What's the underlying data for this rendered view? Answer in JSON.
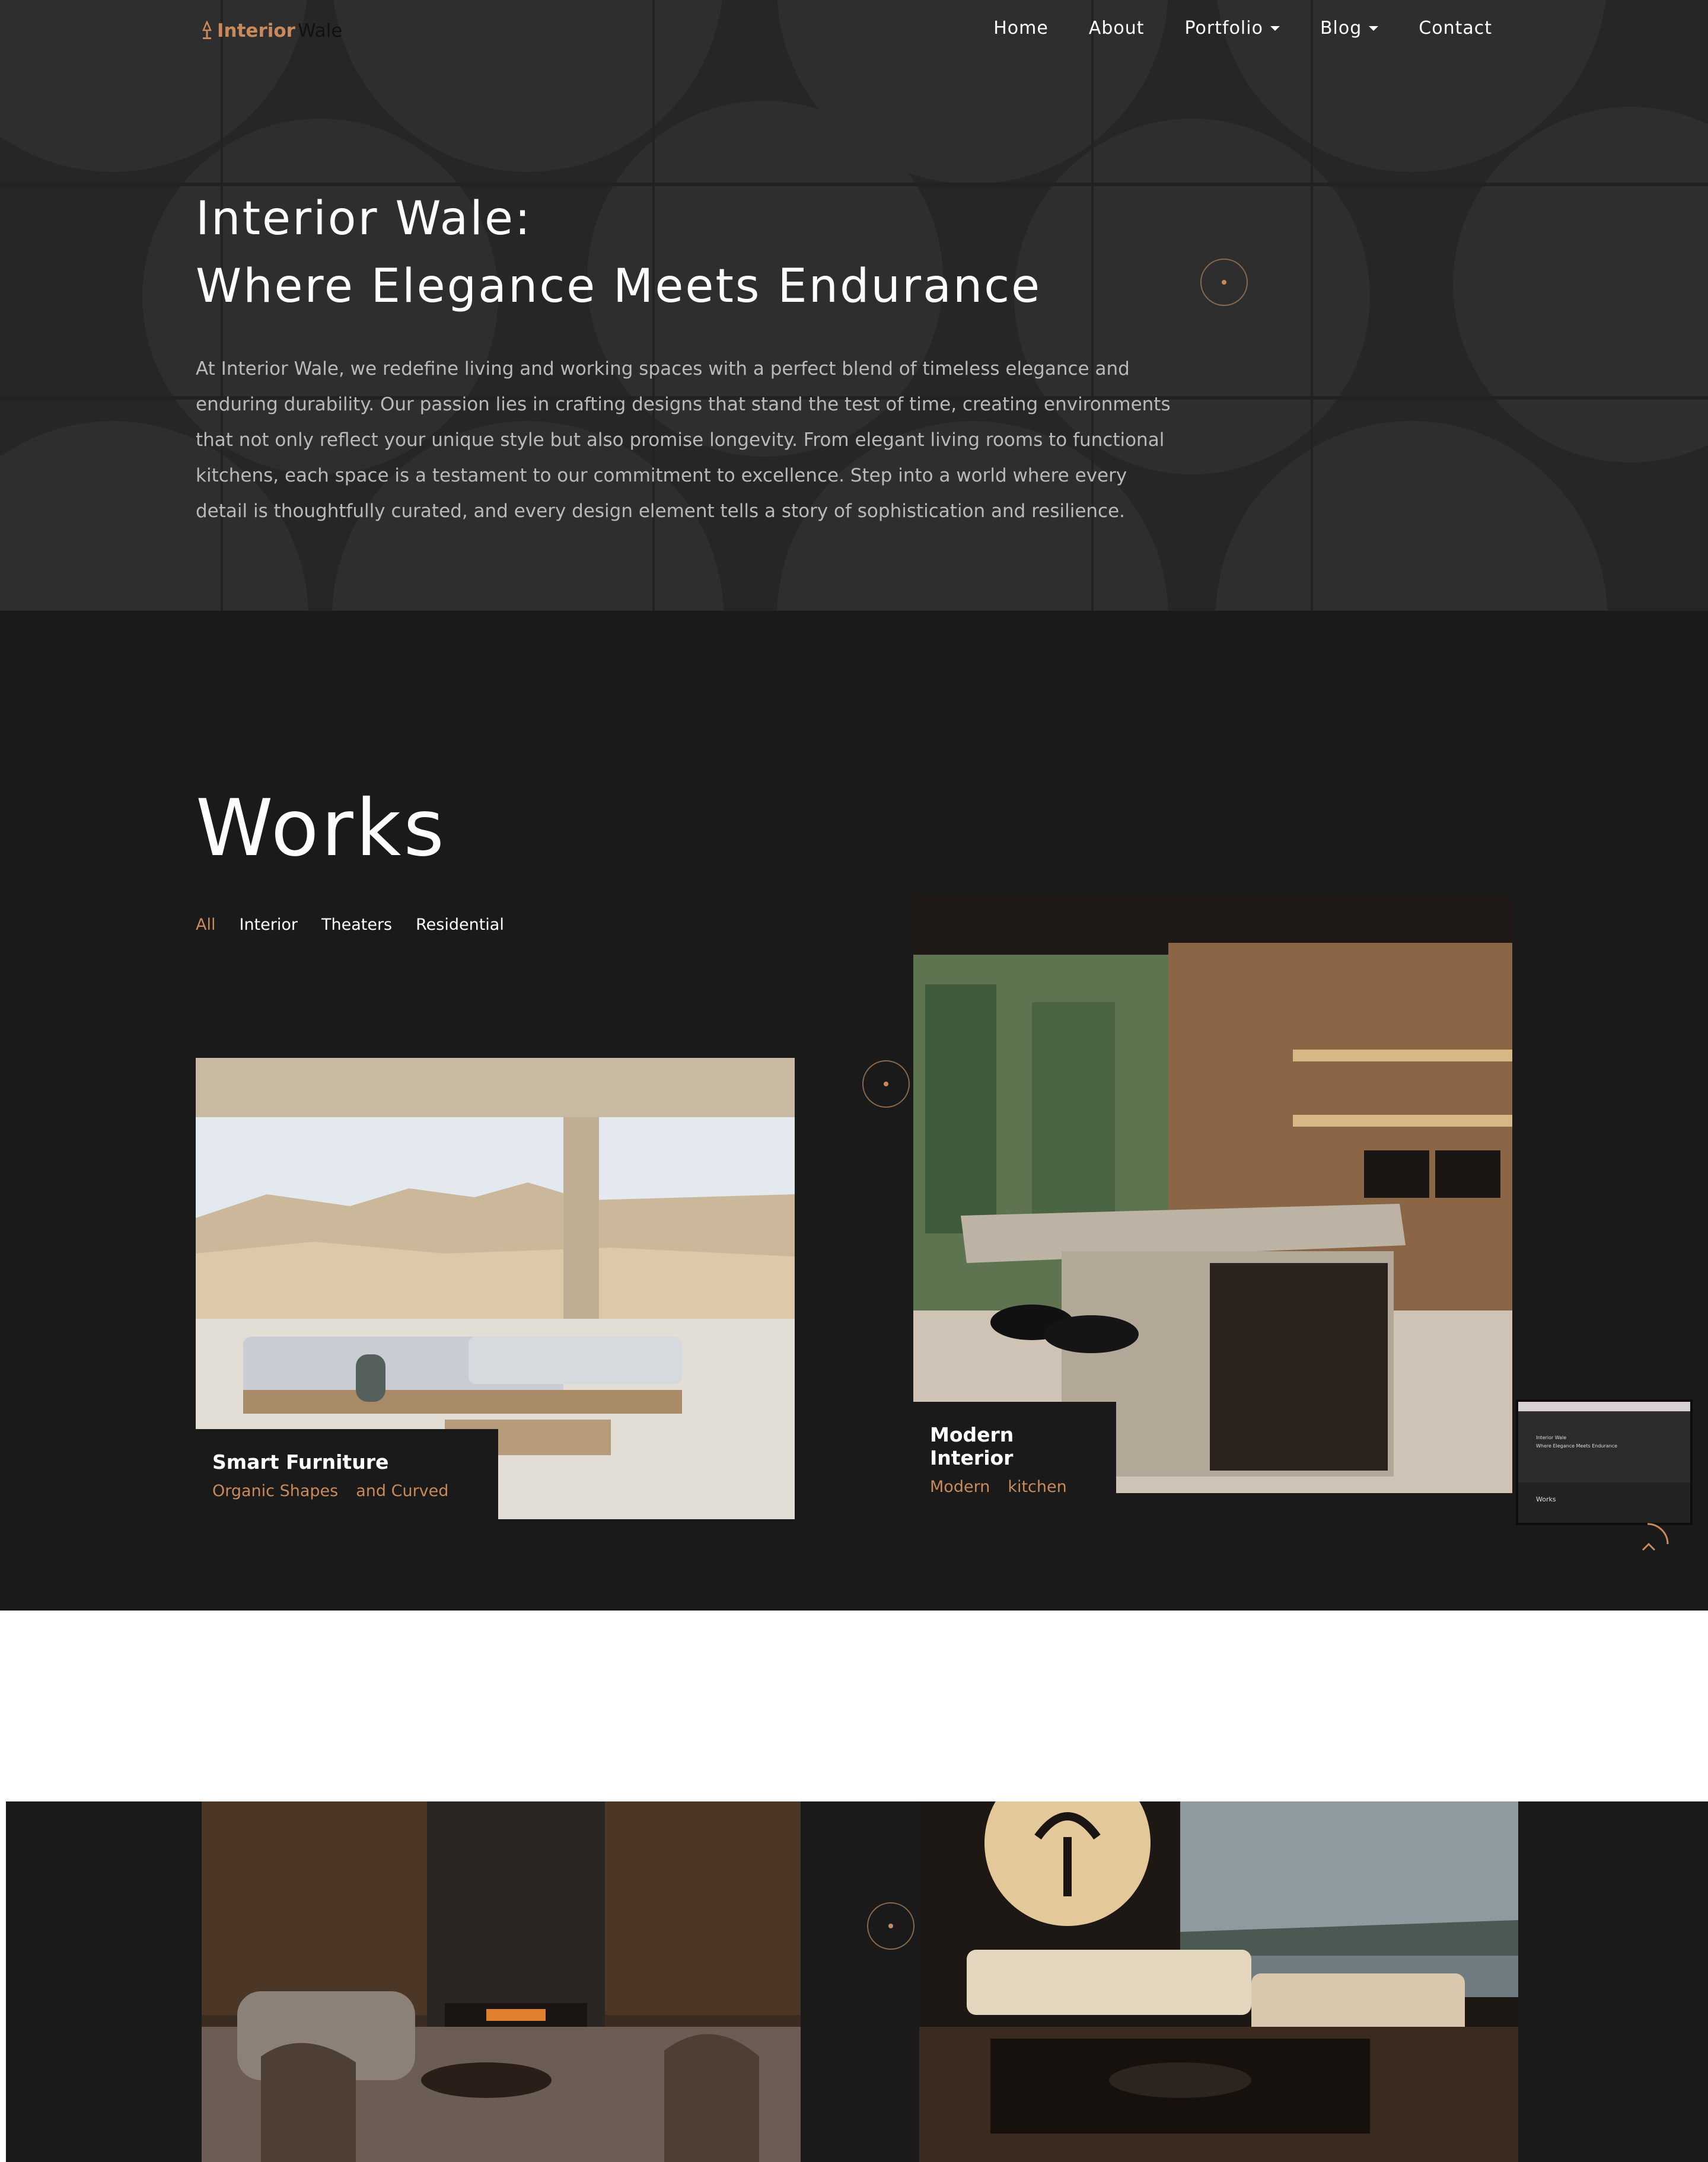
{
  "brand": {
    "part1": "Interior",
    "part2": "Wale"
  },
  "nav": [
    {
      "label": "Home",
      "dropdown": false
    },
    {
      "label": "About",
      "dropdown": false
    },
    {
      "label": "Portfolio",
      "dropdown": true
    },
    {
      "label": "Blog",
      "dropdown": true
    },
    {
      "label": "Contact",
      "dropdown": false
    }
  ],
  "hero": {
    "title_line1": "Interior Wale:",
    "title_line2": "Where Elegance Meets Endurance",
    "text": "At Interior Wale, we redefine living and working spaces with a perfect blend of timeless elegance and enduring durability. Our passion lies in crafting designs that stand the test of time, creating environments that not only reflect your unique style but also promise longevity. From elegant living rooms to functional kitchens, each space is a testament to our commitment to excellence. Step into a world where every detail is thoughtfully curated, and every design element tells a story of sophistication and resilience."
  },
  "works": {
    "title": "Works",
    "filters": [
      "All",
      "Interior",
      "Theaters",
      "Residential"
    ],
    "active_filter": "All",
    "cards": [
      {
        "title": "Smart Furniture",
        "tags": [
          "Organic Shapes",
          "and Curved"
        ]
      },
      {
        "title": "Modern Interior",
        "tags": [
          "Modern",
          "kitchen"
        ]
      }
    ]
  },
  "thumbnail": {
    "title_line1": "Interior Wale",
    "title_line2": "Where Elegance Meets Endurance",
    "section": "Works"
  },
  "colors": {
    "accent": "#c98a5b",
    "hero_bg": "#262626",
    "section_bg": "#1a1a1a"
  }
}
